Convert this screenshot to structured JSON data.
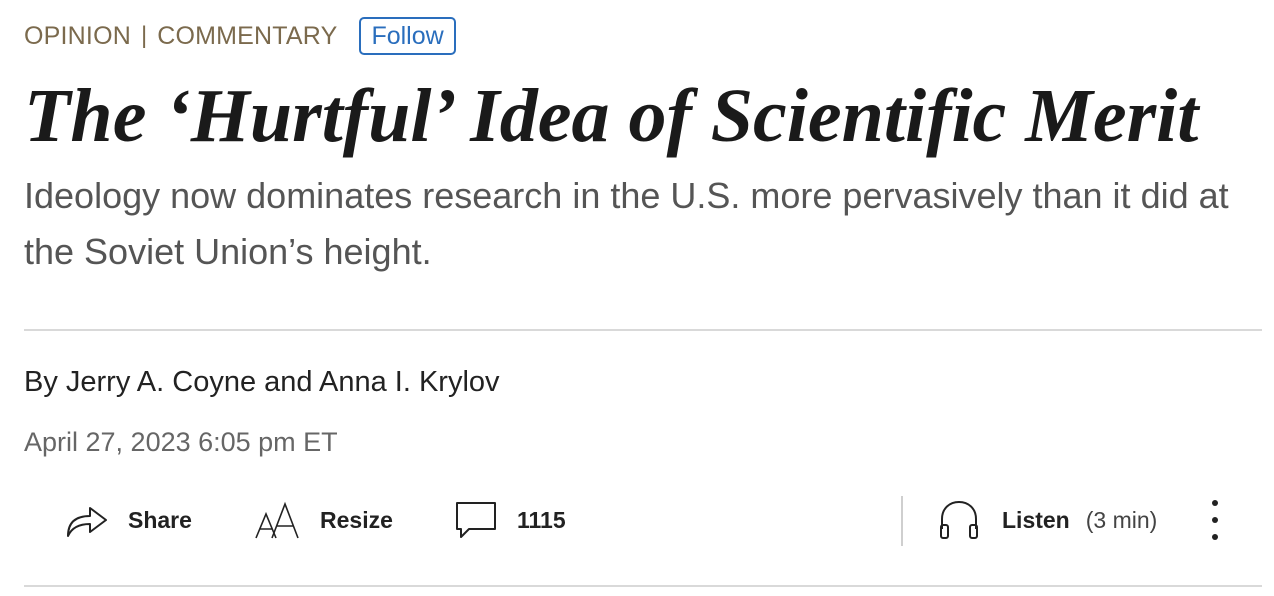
{
  "header": {
    "section": "OPINION",
    "separator": "|",
    "subsection": "COMMENTARY",
    "follow_label": "Follow"
  },
  "article": {
    "headline": "The ‘Hurtful’ Idea of Scientific Merit",
    "dek": "Ideology now dominates research in the U.S. more pervasively than it did at the Soviet Union’s height.",
    "byline": "By Jerry A. Coyne and Anna I. Krylov",
    "dateline": "April 27, 2023 6:05 pm ET"
  },
  "toolbar": {
    "share_label": "Share",
    "share_icon": "share-arrow-icon",
    "resize_label": "Resize",
    "resize_icon": "text-resize-icon",
    "comments_count": "1115",
    "comments_icon": "comment-bubble-icon",
    "listen_label": "Listen",
    "listen_duration": "(3 min)",
    "listen_icon": "headphones-icon",
    "more_icon": "more-vertical-icon"
  },
  "colors": {
    "section": "#7b6a4d",
    "accent": "#2a6ebd",
    "headline": "#1a1a1a",
    "dek": "#555555"
  }
}
